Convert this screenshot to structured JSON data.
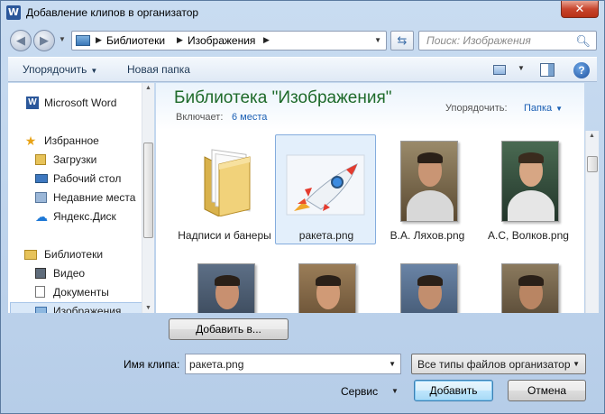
{
  "window": {
    "title": "Добавление клипов в организатор",
    "close_glyph": "✕"
  },
  "navbar": {
    "back_glyph": "◀",
    "forward_glyph": "▶",
    "path": [
      "Библиотеки",
      "Изображения"
    ],
    "search_placeholder": "Поиск: Изображения"
  },
  "toolbar": {
    "organize": "Упорядочить",
    "new_folder": "Новая папка",
    "help": "?"
  },
  "sidebar": {
    "items": [
      {
        "label": "Microsoft Word",
        "icon": "word-icon"
      },
      {
        "label": "Избранное",
        "icon": "star-icon"
      },
      {
        "label": "Загрузки",
        "icon": "downloads-icon"
      },
      {
        "label": "Рабочий стол",
        "icon": "desktop-icon"
      },
      {
        "label": "Недавние места",
        "icon": "recent-places-icon"
      },
      {
        "label": "Яндекс.Диск",
        "icon": "yandex-disk-icon"
      },
      {
        "label": "Библиотеки",
        "icon": "libraries-icon"
      },
      {
        "label": "Видео",
        "icon": "video-icon"
      },
      {
        "label": "Документы",
        "icon": "documents-icon"
      },
      {
        "label": "Изображения",
        "icon": "pictures-icon",
        "selected": true
      }
    ]
  },
  "library": {
    "title": "Библиотека \"Изображения\"",
    "includes_label": "Включает:",
    "includes_link": "6 места",
    "arrange_label": "Упорядочить:",
    "arrange_value": "Папка"
  },
  "files": [
    {
      "name": "Надписи и банеры",
      "kind": "folder"
    },
    {
      "name": "ракета.png",
      "kind": "rocket",
      "selected": true
    },
    {
      "name": "В.А. Ляхов.png",
      "kind": "photo"
    },
    {
      "name": "А.С, Волков.png",
      "kind": "photo"
    },
    {
      "name": "",
      "kind": "photo"
    },
    {
      "name": "",
      "kind": "photo"
    },
    {
      "name": "",
      "kind": "photo"
    },
    {
      "name": "",
      "kind": "photo"
    }
  ],
  "footer": {
    "add_to": "Добавить в...",
    "clip_name_label": "Имя клипа:",
    "clip_name_value": "ракета.png",
    "file_type": "Все типы файлов организатор",
    "service": "Сервис",
    "add": "Добавить",
    "cancel": "Отмена"
  },
  "colors": {
    "library_title": "#1e6a2a",
    "link": "#1a5fb4",
    "selection": "#e3effb"
  }
}
